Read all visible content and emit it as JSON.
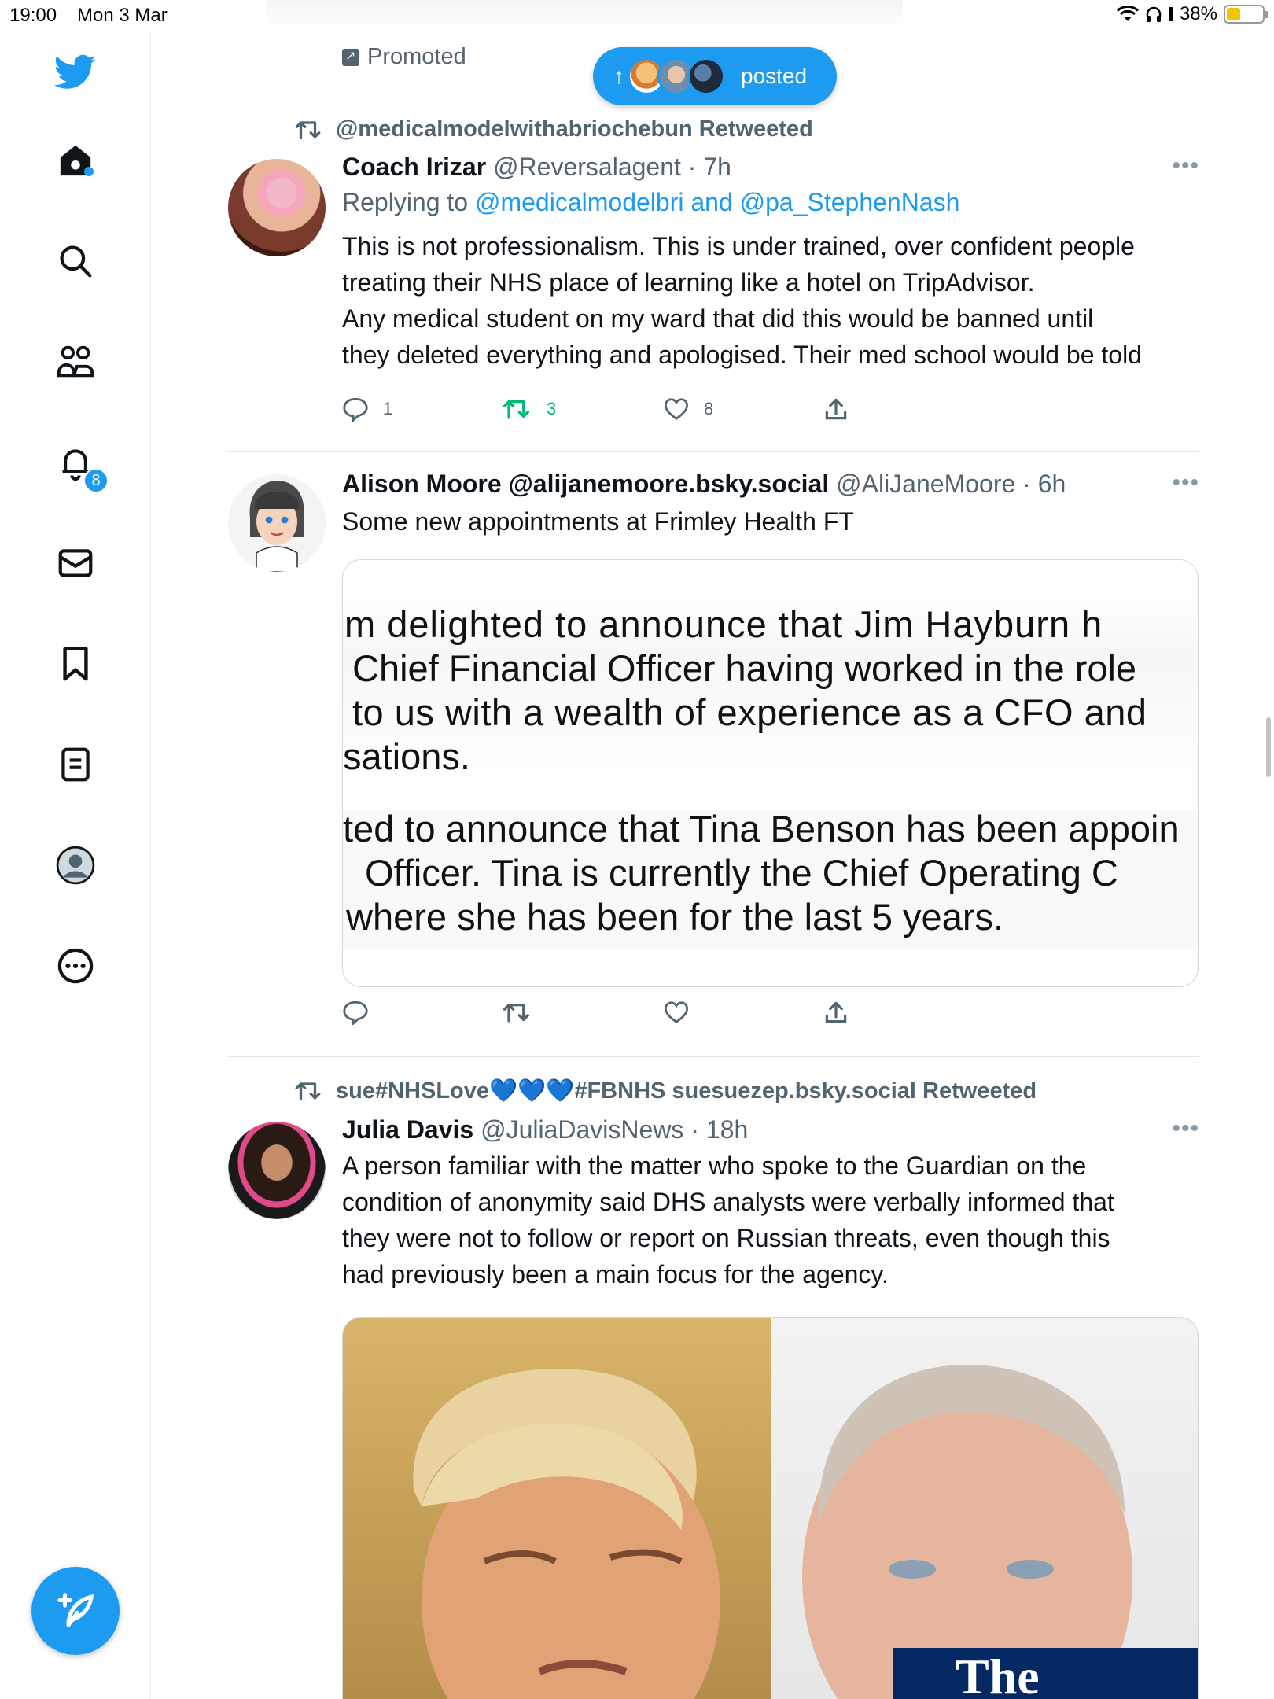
{
  "status_bar": {
    "time": "19:00",
    "date": "Mon 3 Mar",
    "battery_percent": "38%",
    "battery_level": 0.38
  },
  "sidebar": {
    "items": [
      {
        "name": "twitter-logo",
        "icon": "bird-icon"
      },
      {
        "name": "home",
        "icon": "home-icon",
        "has_dot": true
      },
      {
        "name": "explore",
        "icon": "search-icon"
      },
      {
        "name": "communities",
        "icon": "communities-icon"
      },
      {
        "name": "notifications",
        "icon": "bell-icon",
        "badge": "8"
      },
      {
        "name": "messages",
        "icon": "mail-icon"
      },
      {
        "name": "bookmarks",
        "icon": "bookmark-icon"
      },
      {
        "name": "lists",
        "icon": "list-icon"
      },
      {
        "name": "profile",
        "icon": "profile-icon"
      },
      {
        "name": "more",
        "icon": "more-circle-icon"
      }
    ],
    "compose_icon": "compose-icon"
  },
  "feed": {
    "promoted_label": "Promoted",
    "new_posts_pill": {
      "label": "posted",
      "arrow": "↑"
    },
    "tweets": [
      {
        "retweeted_by": "@medicalmodelwithabriochebun Retweeted",
        "name": "Coach Irizar",
        "handle": "@Reversalagent",
        "time": "· 7h",
        "replying_prefix": "Replying to",
        "replying_to": "@medicalmodelbri and @pa_StephenNash",
        "text_lines": [
          "This is not professionalism. This is under trained, over confident people",
          "treating their NHS place of learning like a hotel on TripAdvisor.",
          "Any medical student on my ward that did this would be banned  until",
          "they deleted everything and apologised. Their med school would be told"
        ],
        "reply_count": "1",
        "retweet_count": "3",
        "like_count": "8"
      },
      {
        "name": "Alison Moore @alijanemoore.bsky.social",
        "handle": "@AliJaneMoore",
        "time": "· 6h",
        "text": "Some new appointments at Frimley Health FT",
        "image_text_lines": [
          "m  delighted  to  announce  that  Jim  Hayburn  h",
          "Chief Financial Officer having worked in the role",
          "to us with a wealth of experience as a CFO and",
          "sations.",
          "ted to announce that Tina Benson has been appoin",
          "Officer.  Tina  is  currently  the  Chief  Operating  C",
          "where she has been for the last 5 years."
        ]
      },
      {
        "retweeted_by": "sue#NHSLove💙💙💙#FBNHS suesuezep.bsky.social Retweeted",
        "name": "Julia Davis",
        "handle": "@JuliaDavisNews",
        "time": "· 18h",
        "text_lines": [
          "A person familiar with the matter who spoke to the Guardian on the",
          "condition of anonymity said DHS analysts were verbally informed that",
          "they were not to follow or report on Russian threats, even though this",
          "had previously been a main focus for the agency."
        ],
        "image_overlay_text": "The"
      }
    ]
  }
}
